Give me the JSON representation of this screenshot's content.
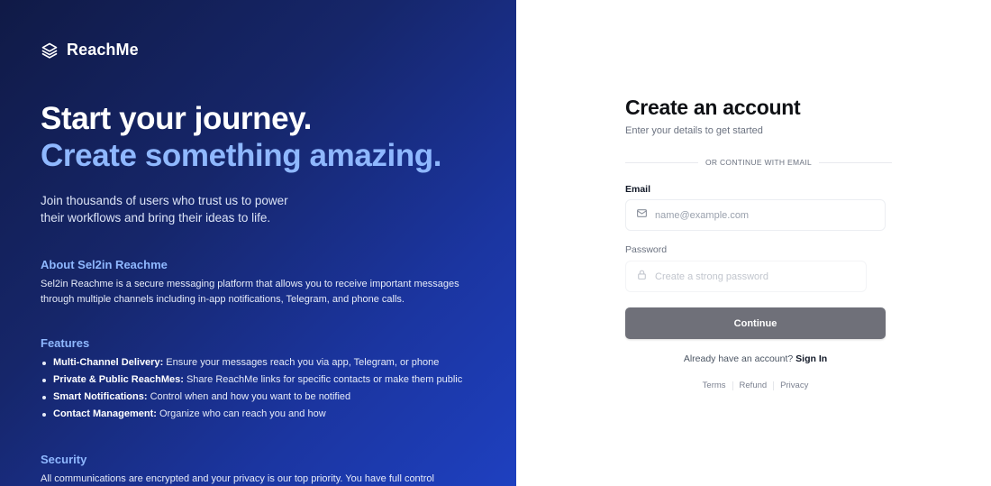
{
  "hero": {
    "brand_name": "ReachMe",
    "headline_line1": "Start your journey.",
    "headline_line2": "Create something amazing.",
    "subtitle": "Join thousands of users who trust us to power their workflows and bring their ideas to life.",
    "about_title": "About Sel2in Reachme",
    "about_text": "Sel2in Reachme is a secure messaging platform that allows you to receive important messages through multiple channels including in-app notifications, Telegram, and phone calls.",
    "features_title": "Features",
    "features": [
      {
        "title": "Multi-Channel Delivery:",
        "text": " Ensure your messages reach you via app, Telegram, or phone"
      },
      {
        "title": "Private & Public ReachMes:",
        "text": " Share ReachMe links for specific contacts or make them public"
      },
      {
        "title": "Smart Notifications:",
        "text": " Control when and how you want to be notified"
      },
      {
        "title": "Contact Management:",
        "text": " Organize who can reach you and how"
      }
    ],
    "security_title": "Security",
    "security_text": "All communications are encrypted and your privacy is our top priority. You have full control"
  },
  "form": {
    "title": "Create an account",
    "subtitle": "Enter your details to get started",
    "divider_text": "OR CONTINUE WITH EMAIL",
    "email_label": "Email",
    "email_placeholder": "name@example.com",
    "password_label": "Password",
    "password_placeholder": "Create a strong password",
    "continue_label": "Continue",
    "signin_prompt": "Already have an account?",
    "signin_link": "Sign In",
    "footer_links": [
      "Terms",
      "Refund",
      "Privacy"
    ]
  },
  "icons": {
    "brand": "layers-icon",
    "email": "mail-icon",
    "password": "lock-icon"
  },
  "colors": {
    "hero_accent": "#8fb8ff",
    "button_bg": "#6f7079",
    "hero_gradient_start": "#101a46",
    "hero_gradient_end": "#1e40c0"
  }
}
